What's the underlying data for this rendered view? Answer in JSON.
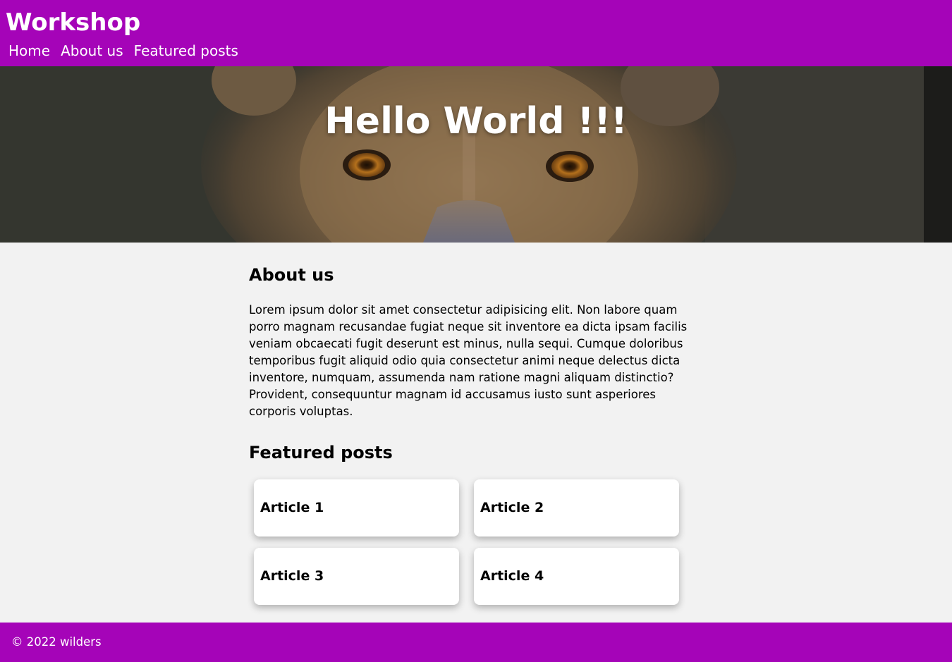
{
  "header": {
    "site_title": "Workshop",
    "nav": [
      {
        "label": "Home"
      },
      {
        "label": "About us"
      },
      {
        "label": "Featured posts"
      }
    ],
    "background_color": "#a504b8"
  },
  "hero": {
    "title": "Hello World !!!",
    "image_subject": "lioness-face"
  },
  "about": {
    "title": "About us",
    "text": "Lorem ipsum dolor sit amet consectetur adipisicing elit. Non labore quam porro magnam recusandae fugiat neque sit inventore ea dicta ipsam facilis veniam obcaecati fugit deserunt est minus, nulla sequi. Cumque doloribus temporibus fugit aliquid odio quia consectetur animi neque delectus dicta inventore, numquam, assumenda nam ratione magni aliquam distinctio? Provident, consequuntur magnam id accusamus iusto sunt asperiores corporis voluptas."
  },
  "featured": {
    "title": "Featured posts",
    "articles": [
      {
        "title": "Article 1"
      },
      {
        "title": "Article 2"
      },
      {
        "title": "Article 3"
      },
      {
        "title": "Article 4"
      }
    ]
  },
  "footer": {
    "text": "© 2022 wilders",
    "background_color": "#a504b8"
  }
}
